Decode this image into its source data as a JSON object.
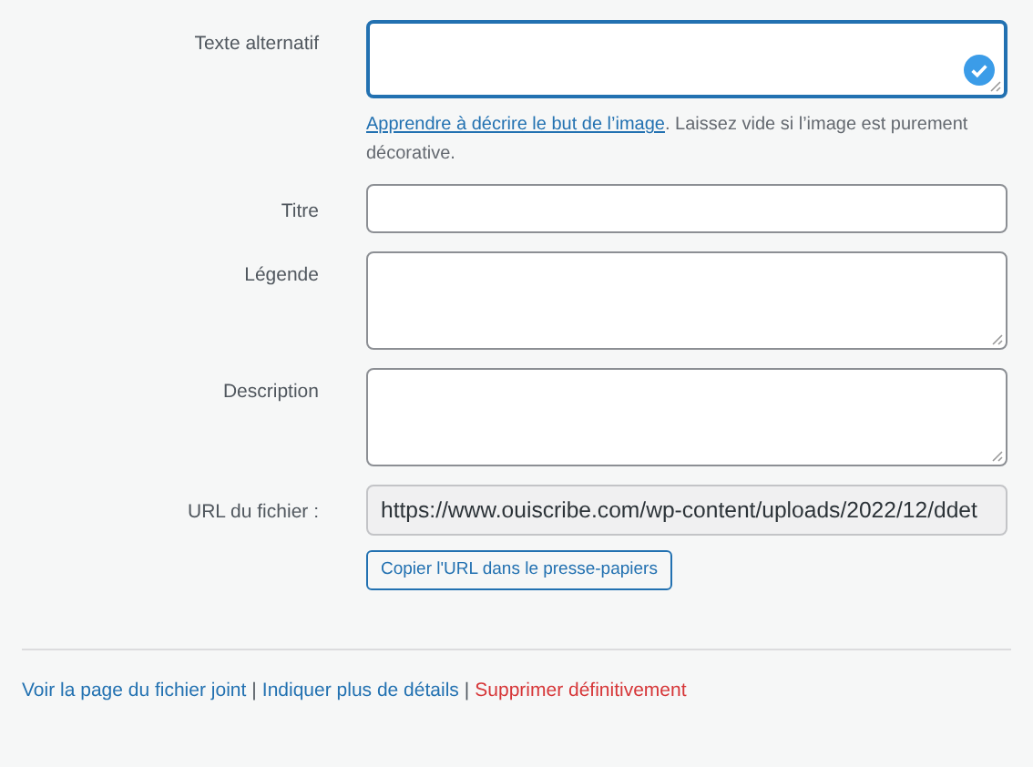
{
  "fields": [
    {
      "label": "Texte alternatif",
      "kind": "textarea",
      "focused": true,
      "valid": true,
      "help": {
        "link": "Apprendre à décrire le but de l’image",
        "text": ". Laissez vide si l’image est purement décorative."
      }
    },
    {
      "label": "Titre",
      "kind": "input",
      "focused": false
    },
    {
      "label": "Légende",
      "kind": "textarea",
      "focused": false
    },
    {
      "label": "Description",
      "kind": "textarea",
      "focused": false
    },
    {
      "label": "URL du fichier :",
      "kind": "readonly",
      "value": "https://www.ouiscribe.com/wp-content/uploads/2022/12/ddet",
      "button": "Copier l'URL dans le presse-papiers"
    }
  ],
  "actions": {
    "separator": "|",
    "links": [
      {
        "label": "Voir la page du fichier joint",
        "kind": "normal"
      },
      {
        "label": "Indiquer plus de détails",
        "kind": "normal"
      },
      {
        "label": "Supprimer définitivement",
        "kind": "delete"
      }
    ]
  }
}
